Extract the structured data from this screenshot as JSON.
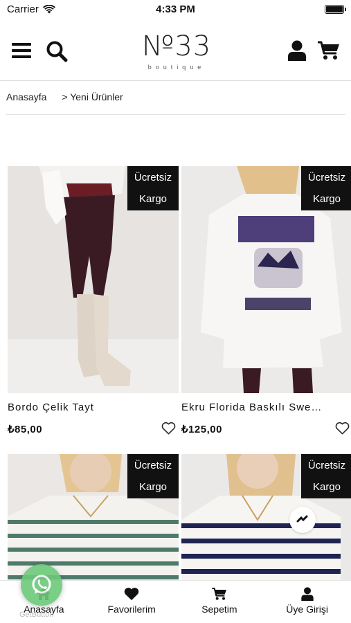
{
  "status_bar": {
    "carrier": "Carrier",
    "time": "4:33 PM"
  },
  "header": {
    "logo_main": "№33",
    "logo_sub": "boutique",
    "icons": [
      "menu-icon",
      "search-icon",
      "user-icon",
      "cart-icon"
    ]
  },
  "breadcrumb": {
    "home": "Anasayfa",
    "current": "> Yeni Ürünler"
  },
  "products": [
    {
      "badge_line1": "Ücretsiz",
      "badge_line2": "Kargo",
      "name": "Bordo Çelik Tayt",
      "price": "₺85,00"
    },
    {
      "badge_line1": "Ücretsiz",
      "badge_line2": "Kargo",
      "name": "Ekru Florida Baskılı Swe…",
      "price": "₺125,00"
    },
    {
      "badge_line1": "Ücretsiz",
      "badge_line2": "Kargo",
      "name": "",
      "price": ""
    },
    {
      "badge_line1": "Ücretsiz",
      "badge_line2": "Kargo",
      "name": "",
      "price": ""
    }
  ],
  "tabbar": {
    "home": "Anasayfa",
    "favorites": "Favorilerim",
    "cart": "Sepetim",
    "login": "Üye Girişi"
  },
  "whatsapp": {
    "label": "GetButton"
  },
  "colors": {
    "badge_bg": "#111111",
    "whatsapp_green": "#6cc97a"
  }
}
